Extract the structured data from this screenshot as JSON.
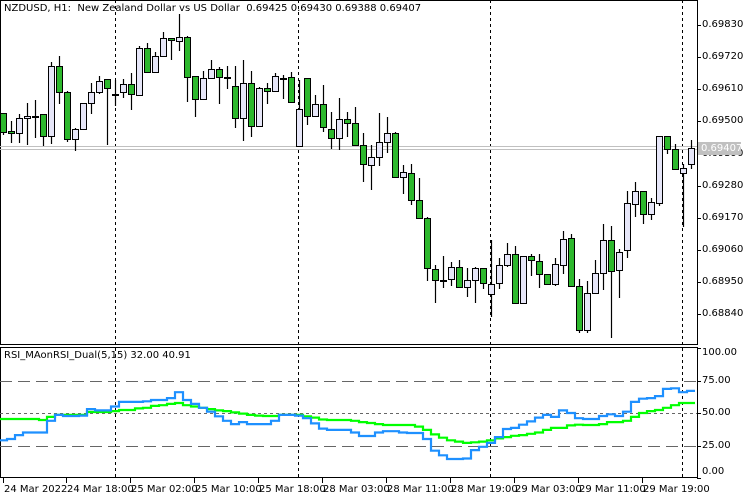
{
  "header": {
    "symbol_title": "NZDUSD, H1:  New Zealand Dollar vs US Dollar",
    "ohlc": "0.69425 0.69430 0.69388 0.69407"
  },
  "price_axis": [
    "0.69830",
    "0.69720",
    "0.69610",
    "0.69500",
    "0.69390",
    "0.69280",
    "0.69170",
    "0.69060",
    "0.68950",
    "0.68840"
  ],
  "bid_label": "0.69407",
  "bid_price": 0.69407,
  "ask_price": 0.69416,
  "indicator": {
    "title": "RSI_MAonRSI_Dual(5,15) 32.00 40.91",
    "axis": [
      "100.00",
      "75.00",
      "50.00",
      "25.00",
      "0.00"
    ],
    "levels": [
      75,
      50,
      25
    ],
    "colors": {
      "rsi": "#1e90ff",
      "ma": "#00ff00"
    }
  },
  "time_axis": [
    "24 Mar 2022",
    "24 Mar 18:00",
    "25 Mar 02:00",
    "25 Mar 10:00",
    "25 Mar 18:00",
    "28 Mar 03:00",
    "28 Mar 11:00",
    "28 Mar 19:00",
    "29 Mar 03:00",
    "29 Mar 11:00",
    "29 Mar 19:00"
  ],
  "colors": {
    "bull_body": "#e6e6f8",
    "bear_body": "#2db82d",
    "grid": "#000000",
    "bid_line": "#c0c0c0"
  },
  "chart_data": {
    "type": "candlestick",
    "ylim": [
      0.6876,
      0.699
    ],
    "candles_ohlc": [
      [
        0.69529,
        0.69529,
        0.69454,
        0.69464
      ],
      [
        0.69467,
        0.69502,
        0.69426,
        0.6946
      ],
      [
        0.6946,
        0.69525,
        0.69426,
        0.69512
      ],
      [
        0.69512,
        0.69563,
        0.69419,
        0.69519
      ],
      [
        0.69519,
        0.69573,
        0.69443,
        0.69519
      ],
      [
        0.69525,
        0.69525,
        0.69416,
        0.6945
      ],
      [
        0.6945,
        0.69703,
        0.69423,
        0.6969
      ],
      [
        0.6969,
        0.69724,
        0.6956,
        0.69601
      ],
      [
        0.69601,
        0.69604,
        0.6943,
        0.6944
      ],
      [
        0.6944,
        0.69478,
        0.69399,
        0.69474
      ],
      [
        0.69474,
        0.69563,
        0.69474,
        0.69563
      ],
      [
        0.69563,
        0.69632,
        0.69525,
        0.69601
      ],
      [
        0.69601,
        0.69655,
        0.69594,
        0.69638
      ],
      [
        0.69645,
        0.69645,
        0.69419,
        0.69614
      ],
      [
        0.69594,
        0.69642,
        0.69553,
        0.69594
      ],
      [
        0.69601,
        0.69645,
        0.6958,
        0.69628
      ],
      [
        0.69628,
        0.69666,
        0.69539,
        0.69594
      ],
      [
        0.6959,
        0.69758,
        0.6959,
        0.69751
      ],
      [
        0.69751,
        0.69768,
        0.69666,
        0.69669
      ],
      [
        0.69669,
        0.69738,
        0.69666,
        0.69724
      ],
      [
        0.69724,
        0.69806,
        0.6972,
        0.69785
      ],
      [
        0.69785,
        0.69785,
        0.6971,
        0.69779
      ],
      [
        0.69775,
        0.69868,
        0.69741,
        0.69789
      ],
      [
        0.69789,
        0.69792,
        0.69567,
        0.69652
      ],
      [
        0.69655,
        0.69655,
        0.69515,
        0.69577
      ],
      [
        0.69577,
        0.69673,
        0.69573,
        0.69649
      ],
      [
        0.69649,
        0.6971,
        0.69649,
        0.69679
      ],
      [
        0.69679,
        0.69686,
        0.6956,
        0.69652
      ],
      [
        0.69652,
        0.6969,
        0.69611,
        0.69652
      ],
      [
        0.69621,
        0.6969,
        0.69478,
        0.69512
      ],
      [
        0.69512,
        0.6971,
        0.69433,
        0.69632
      ],
      [
        0.69632,
        0.69673,
        0.69447,
        0.69484
      ],
      [
        0.69484,
        0.69618,
        0.69484,
        0.69614
      ],
      [
        0.69614,
        0.69632,
        0.6956,
        0.69604
      ],
      [
        0.69604,
        0.69666,
        0.69604,
        0.69655
      ],
      [
        0.69649,
        0.69659,
        0.69577,
        0.69649
      ],
      [
        0.69652,
        0.69669,
        0.69567,
        0.69567
      ],
      [
        0.69416,
        0.69642,
        0.69416,
        0.69543
      ],
      [
        0.69649,
        0.69649,
        0.69488,
        0.69519
      ],
      [
        0.69519,
        0.6959,
        0.69515,
        0.6956
      ],
      [
        0.6956,
        0.69625,
        0.69464,
        0.69481
      ],
      [
        0.69474,
        0.69532,
        0.69406,
        0.69443
      ],
      [
        0.69443,
        0.6958,
        0.69402,
        0.69508
      ],
      [
        0.69508,
        0.69532,
        0.69447,
        0.69495
      ],
      [
        0.69495,
        0.69549,
        0.69419,
        0.69419
      ],
      [
        0.69419,
        0.6946,
        0.69293,
        0.69354
      ],
      [
        0.69351,
        0.69419,
        0.69265,
        0.69378
      ],
      [
        0.69378,
        0.69529,
        0.69348,
        0.6943
      ],
      [
        0.6943,
        0.69515,
        0.69392,
        0.6946
      ],
      [
        0.6946,
        0.69464,
        0.6931,
        0.6931
      ],
      [
        0.6931,
        0.69351,
        0.69252,
        0.69327
      ],
      [
        0.69324,
        0.69354,
        0.69214,
        0.69231
      ],
      [
        0.69231,
        0.69306,
        0.6917,
        0.6917
      ],
      [
        0.6917,
        0.69173,
        0.68954,
        0.68998
      ],
      [
        0.68995,
        0.69009,
        0.68879,
        0.68957
      ],
      [
        0.68957,
        0.6904,
        0.6893,
        0.68957
      ],
      [
        0.68961,
        0.69019,
        0.68937,
        0.69002
      ],
      [
        0.69002,
        0.69026,
        0.68933,
        0.68933
      ],
      [
        0.68933,
        0.68998,
        0.68899,
        0.68957
      ],
      [
        0.68957,
        0.69002,
        0.68879,
        0.68998
      ],
      [
        0.68998,
        0.68998,
        0.68927,
        0.68947
      ],
      [
        0.6891,
        0.69094,
        0.68831,
        0.68944
      ],
      [
        0.68947,
        0.69033,
        0.68927,
        0.69009
      ],
      [
        0.69009,
        0.69084,
        0.69002,
        0.69046
      ],
      [
        0.69046,
        0.69074,
        0.68879,
        0.68879
      ],
      [
        0.68879,
        0.6904,
        0.68879,
        0.6904
      ],
      [
        0.6904,
        0.69046,
        0.68971,
        0.69026
      ],
      [
        0.69022,
        0.69046,
        0.6893,
        0.68978
      ],
      [
        0.68978,
        0.68978,
        0.68944,
        0.68944
      ],
      [
        0.68944,
        0.69033,
        0.68937,
        0.69012
      ],
      [
        0.69009,
        0.69125,
        0.68978,
        0.69098
      ],
      [
        0.69101,
        0.69115,
        0.68937,
        0.68937
      ],
      [
        0.68937,
        0.68961,
        0.68776,
        0.68786
      ],
      [
        0.68786,
        0.68954,
        0.68776,
        0.68913
      ],
      [
        0.68913,
        0.69026,
        0.68913,
        0.68981
      ],
      [
        0.68981,
        0.69149,
        0.68923,
        0.69094
      ],
      [
        0.69094,
        0.69142,
        0.68759,
        0.68988
      ],
      [
        0.68992,
        0.69063,
        0.68896,
        0.69053
      ],
      [
        0.6906,
        0.69262,
        0.69033,
        0.69221
      ],
      [
        0.69217,
        0.69293,
        0.69173,
        0.69262
      ],
      [
        0.69262,
        0.69262,
        0.69149,
        0.69183
      ],
      [
        0.69183,
        0.69238,
        0.69163,
        0.69224
      ],
      [
        0.69221,
        0.6945,
        0.69211,
        0.6945
      ],
      [
        0.6945,
        0.6945,
        0.69389,
        0.69406
      ],
      [
        0.69406,
        0.69423,
        0.69337,
        0.69337
      ],
      [
        0.69324,
        0.69354,
        0.69139,
        0.69341
      ],
      [
        0.69354,
        0.69437,
        0.69337,
        0.69409
      ]
    ],
    "indicator_ylim": [
      0,
      100
    ],
    "rsi": [
      29,
      30,
      33,
      35,
      35,
      35,
      44,
      48.5,
      47.7,
      47.7,
      48,
      53,
      52,
      52,
      55,
      58.5,
      58.5,
      58.5,
      59,
      60,
      60,
      61.5,
      66,
      60,
      57,
      54,
      51,
      47.5,
      44,
      41.5,
      43,
      41.5,
      41.5,
      41.5,
      44,
      48.5,
      48.5,
      48,
      46,
      42,
      38,
      37,
      37,
      37,
      35,
      32.3,
      32.3,
      35,
      36,
      36,
      35,
      34.6,
      34.6,
      30,
      21,
      17.5,
      14.6,
      14.6,
      15,
      21.5,
      24,
      27,
      31.5,
      37.7,
      38.5,
      41,
      43.5,
      46.5,
      48.5,
      47,
      52,
      50,
      46,
      45.4,
      45.4,
      47.7,
      49,
      47.7,
      51,
      58.5,
      61,
      61.5,
      63,
      68.5,
      69,
      66,
      67
    ],
    "ma_on_rsi": [
      45.4,
      45.4,
      45.4,
      45.4,
      45.4,
      44.6,
      47,
      48.5,
      48.5,
      48.5,
      48.5,
      50.8,
      50.8,
      50.8,
      51.5,
      52.3,
      52.3,
      53.5,
      54,
      55.5,
      56,
      57,
      57.7,
      56,
      55,
      54,
      53,
      52,
      51.5,
      50.5,
      49.5,
      48.5,
      48,
      47.7,
      47.7,
      48.5,
      48.5,
      48.5,
      47.5,
      46.5,
      45,
      44.6,
      44.6,
      44.6,
      44,
      43,
      42.3,
      41.5,
      40.8,
      40.8,
      40.8,
      40.8,
      39.5,
      37,
      33.5,
      31,
      29,
      28,
      27,
      27.5,
      28,
      29,
      30.5,
      31.5,
      32.5,
      33,
      34,
      35,
      37,
      38.5,
      38.5,
      40.5,
      41,
      40.8,
      40.8,
      41.5,
      43,
      43,
      44,
      47,
      50,
      51.5,
      52.3,
      54,
      56,
      57.7,
      57.7
    ]
  }
}
